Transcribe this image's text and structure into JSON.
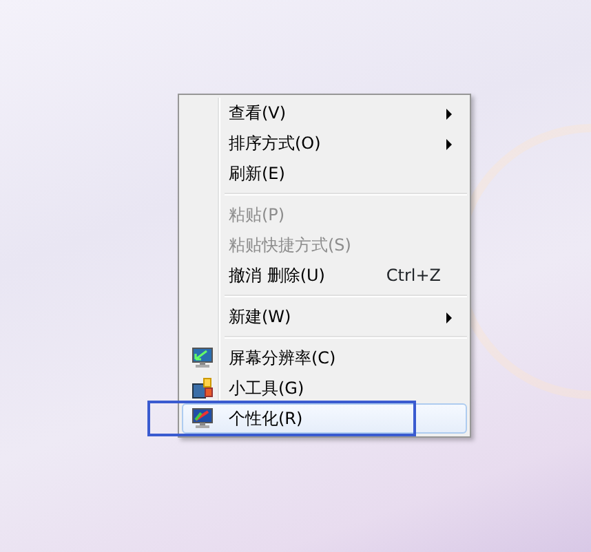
{
  "context_menu": {
    "items": [
      {
        "kind": "item",
        "label": "查看(V)",
        "submenu": true,
        "disabled": false,
        "selected": false
      },
      {
        "kind": "item",
        "label": "排序方式(O)",
        "submenu": true,
        "disabled": false,
        "selected": false
      },
      {
        "kind": "item",
        "label": "刷新(E)",
        "submenu": false,
        "disabled": false,
        "selected": false
      },
      {
        "kind": "separator"
      },
      {
        "kind": "item",
        "label": "粘贴(P)",
        "submenu": false,
        "disabled": true,
        "selected": false
      },
      {
        "kind": "item",
        "label": "粘贴快捷方式(S)",
        "submenu": false,
        "disabled": true,
        "selected": false
      },
      {
        "kind": "item",
        "label": "撤消 删除(U)",
        "shortcut": "Ctrl+Z",
        "submenu": false,
        "disabled": false,
        "selected": false
      },
      {
        "kind": "separator"
      },
      {
        "kind": "item",
        "label": "新建(W)",
        "submenu": true,
        "disabled": false,
        "selected": false
      },
      {
        "kind": "separator"
      },
      {
        "kind": "display",
        "label": "屏幕分辨率(C)",
        "submenu": false,
        "disabled": false,
        "selected": false
      },
      {
        "kind": "gadgets",
        "label": "小工具(G)",
        "submenu": false,
        "disabled": false,
        "selected": false
      },
      {
        "kind": "personalize",
        "label": "个性化(R)",
        "submenu": false,
        "disabled": false,
        "selected": true,
        "outlined": true
      }
    ]
  }
}
